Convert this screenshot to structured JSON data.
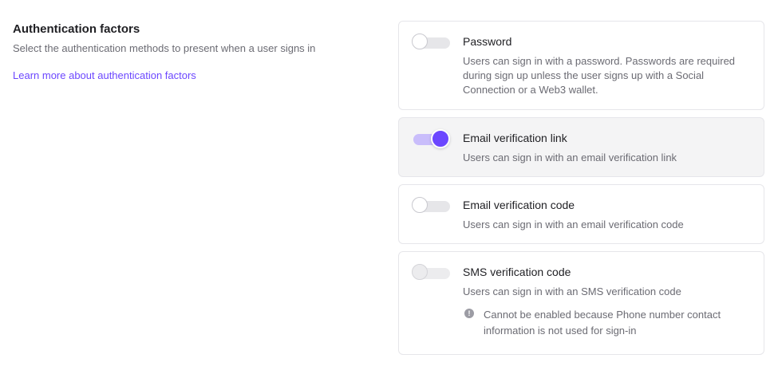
{
  "section": {
    "title": "Authentication factors",
    "description": "Select the authentication methods to present when a user signs in",
    "learn_more": "Learn more about authentication factors"
  },
  "factors": [
    {
      "title": "Password",
      "description": "Users can sign in with a password. Passwords are required during sign up unless the user signs up with a Social Connection or a Web3 wallet.",
      "enabled": false
    },
    {
      "title": "Email verification link",
      "description": "Users can sign in with an email verification link",
      "enabled": true
    },
    {
      "title": "Email verification code",
      "description": "Users can sign in with an email verification code",
      "enabled": false
    },
    {
      "title": "SMS verification code",
      "description": "Users can sign in with an SMS verification code",
      "enabled": false,
      "disabled": true,
      "notice_icon": "!",
      "notice": "Cannot be enabled because Phone number contact information is not used for sign-in"
    }
  ],
  "colors": {
    "accent": "#6c47ff",
    "accent_track": "#c9bdfb",
    "muted_text": "#6b6b73"
  }
}
